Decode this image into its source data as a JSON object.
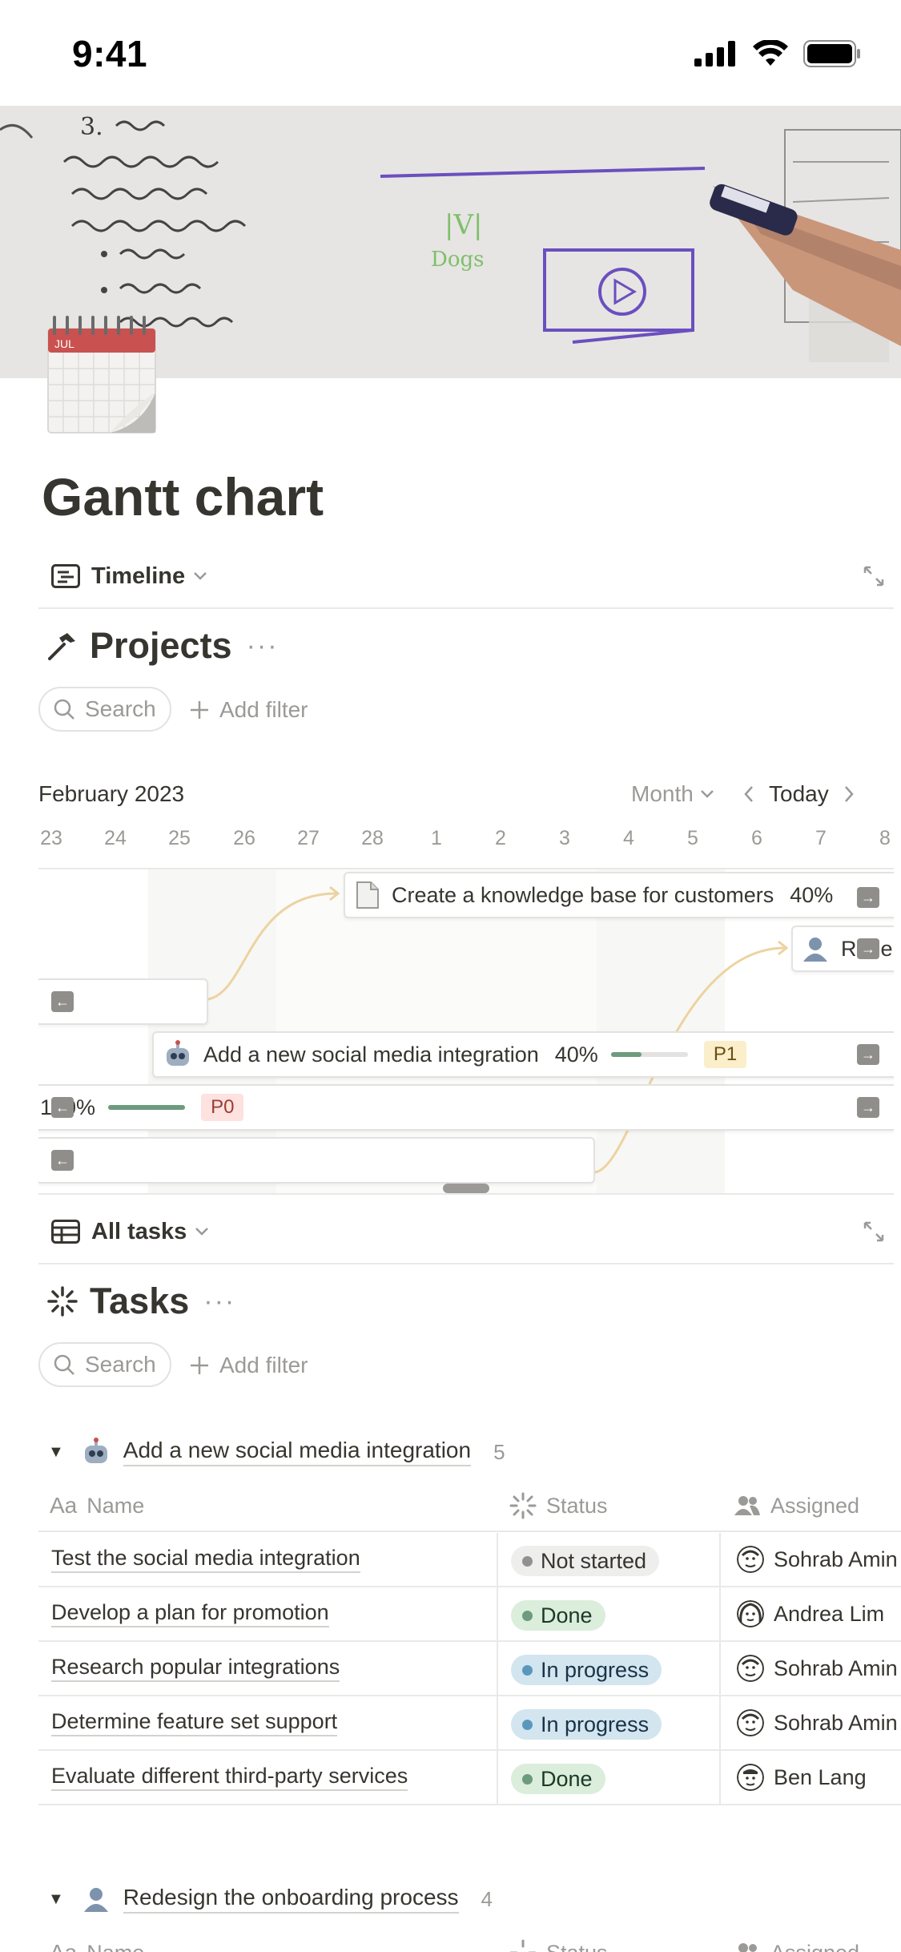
{
  "status_bar": {
    "time": "9:41"
  },
  "page": {
    "title": "Gantt chart"
  },
  "timeline_view": {
    "label": "Timeline"
  },
  "projects": {
    "title": "Projects",
    "search_label": "Search",
    "add_filter_label": "Add filter",
    "month": "February 2023",
    "zoom": "Month",
    "today": "Today",
    "days": [
      "23",
      "24",
      "25",
      "26",
      "27",
      "28",
      "1",
      "2",
      "3",
      "4",
      "5",
      "6",
      "7",
      "8"
    ],
    "bars": [
      {
        "name": "Create a knowledge base for customers",
        "pct": "40%"
      },
      {
        "name": "Rede"
      },
      {
        "name": "Add a new social media integration",
        "pct": "40%",
        "progress": 0.4,
        "tag": "P1"
      },
      {
        "pct": "100%",
        "progress": 1.0,
        "tag": "P0"
      }
    ]
  },
  "tasks_view": {
    "label": "All tasks"
  },
  "tasks": {
    "title": "Tasks",
    "search_label": "Search",
    "add_filter_label": "Add filter",
    "columns": {
      "name": "Name",
      "status": "Status",
      "assigned": "Assigned"
    },
    "groups": [
      {
        "name": "Add a new social media integration",
        "count": "5",
        "rows": [
          {
            "name": "Test the social media integration",
            "status": "Not started",
            "assigned": "Sohrab Amin"
          },
          {
            "name": "Develop a plan for promotion",
            "status": "Done",
            "assigned": "Andrea Lim"
          },
          {
            "name": "Research popular integrations",
            "status": "In progress",
            "assigned": "Sohrab Amin"
          },
          {
            "name": "Determine feature set support",
            "status": "In progress",
            "assigned": "Sohrab Amin"
          },
          {
            "name": "Evaluate different third-party services",
            "status": "Done",
            "assigned": "Ben Lang"
          }
        ]
      },
      {
        "name": "Redesign the onboarding process",
        "count": "4"
      }
    ]
  },
  "colors": {
    "done": "#dbeddb",
    "in_progress": "#d3e5ef",
    "not_started": "#eeeeec",
    "p1": "#fbeecb",
    "p0": "#fde2df"
  }
}
